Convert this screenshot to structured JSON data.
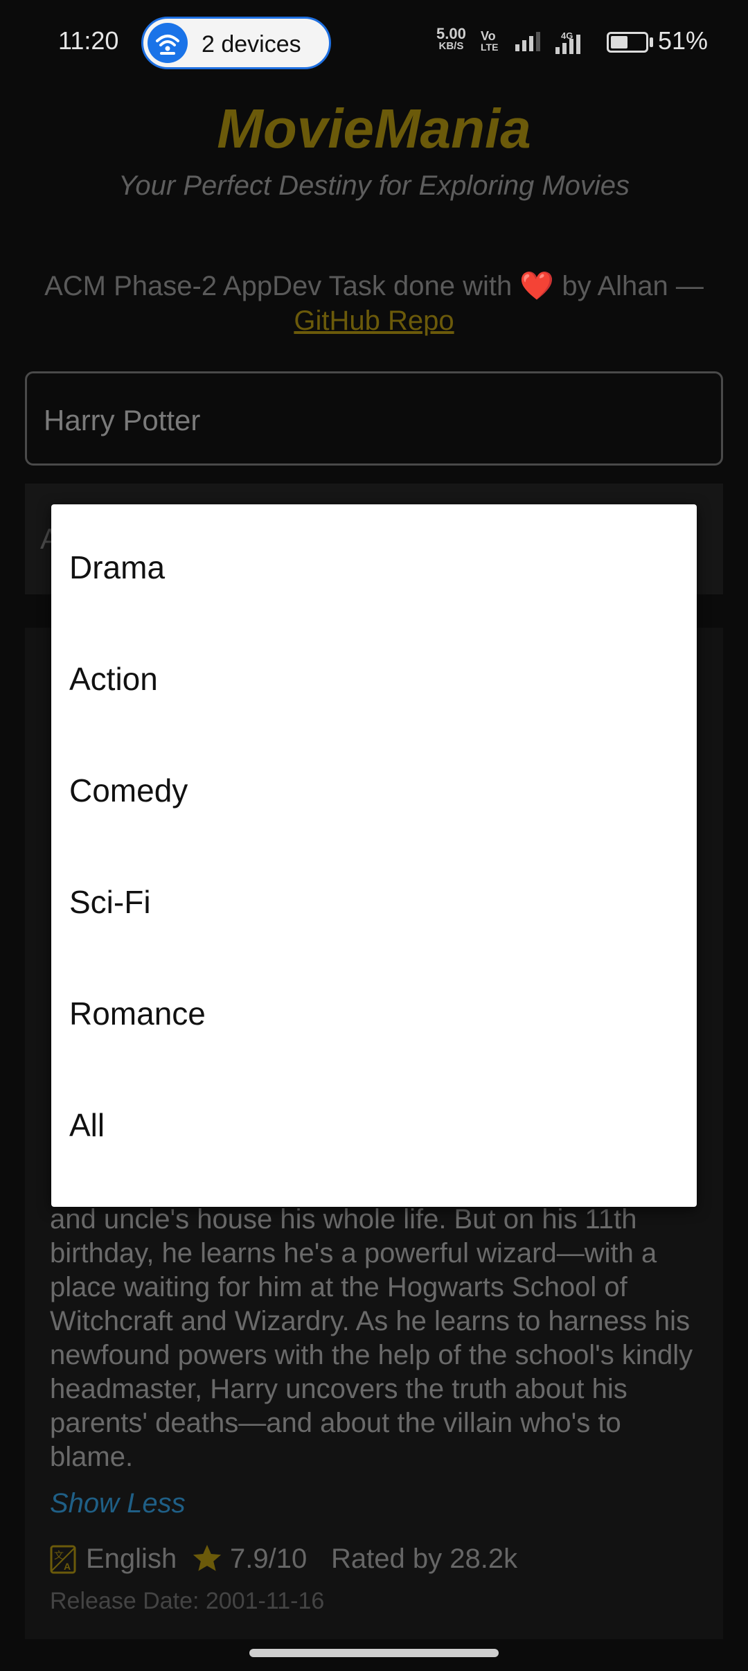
{
  "status_bar": {
    "time": "11:20",
    "hotspot_label": "2 devices",
    "net_speed_value": "5.00",
    "net_speed_unit": "KB/S",
    "volte_top": "Vo",
    "volte_bottom": "LTE",
    "network_type": "4G",
    "battery_percent": "51%",
    "battery_level": 0.51
  },
  "app": {
    "title": "MovieMania",
    "subtitle": "Your Perfect Destiny for Exploring Movies",
    "credit_text": "ACM Phase-2 AppDev Task done with",
    "credit_heart": "❤️",
    "credit_author": "by Alhan —",
    "repo_link": "GitHub Repo",
    "title_color": "#6b5a0a"
  },
  "search": {
    "value": "Harry Potter"
  },
  "genre_select": {
    "peek_letter": "A"
  },
  "dialog": {
    "options": [
      "Drama",
      "Action",
      "Comedy",
      "Sci-Fi",
      "Romance",
      "All"
    ]
  },
  "movie": {
    "overview": "and uncle's house his whole life. But on his 11th birthday, he learns he's a powerful wizard—with a place waiting for him at the Hogwarts School of Witchcraft and Wizardry. As he learns to harness his newfound powers with the help of the school's kindly headmaster, Harry uncovers the truth about his parents' deaths—and about the villain who's to blame.",
    "show_less": "Show Less",
    "language": "English",
    "rating": "7.9/10",
    "rated_by": "Rated by 28.2k",
    "release_date": "Release Date: 2001-11-16"
  }
}
